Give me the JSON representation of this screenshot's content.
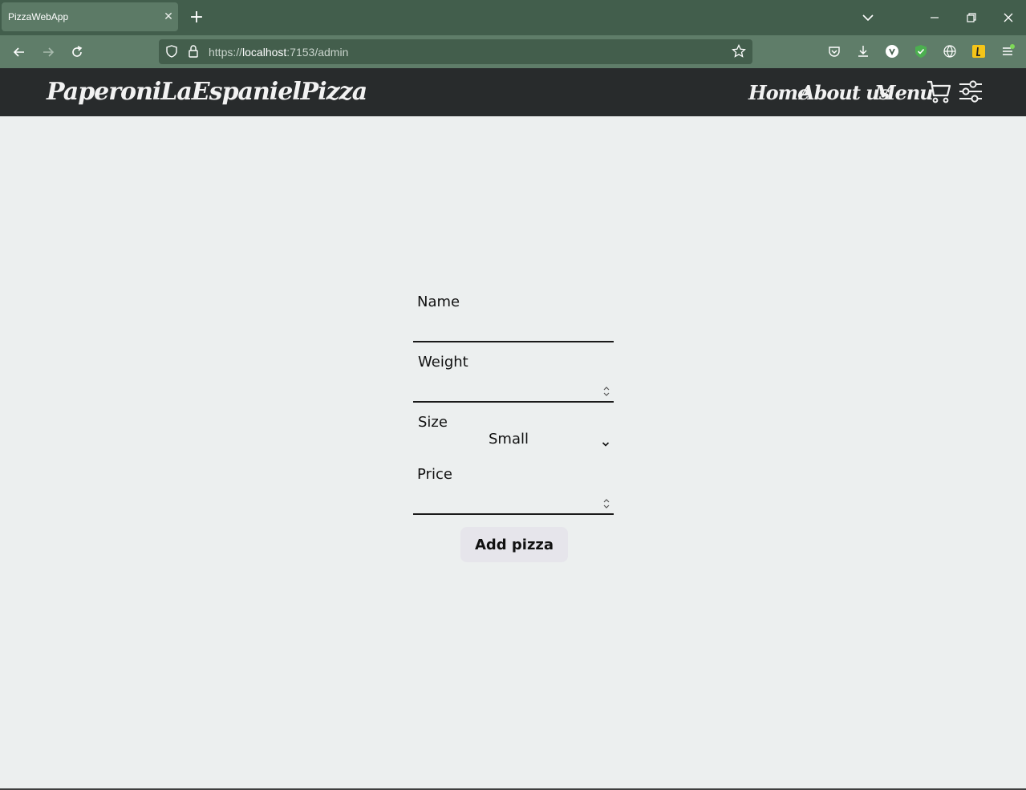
{
  "browser": {
    "tab_title": "PizzaWebApp",
    "url_prefix": "https://",
    "url_host": "localhost",
    "url_path": ":7153/admin",
    "colors": {
      "tabbar": "#425e4c",
      "toolbar": "#5f7d69",
      "urlbar": "#435e4c"
    }
  },
  "site": {
    "brand": "PaperoniLaEspanielPizza",
    "nav": {
      "home": "Home",
      "about": "About us",
      "menu": "Menu"
    },
    "icons": {
      "cart": "cart-icon",
      "settings": "sliders-icon"
    },
    "colors": {
      "header_bg": "#282b2c",
      "page_bg": "#ecefef"
    }
  },
  "form": {
    "name_label": "Name",
    "weight_label": "Weight",
    "size_label": "Size",
    "size_selected": "Small",
    "price_label": "Price",
    "submit_label": "Add pizza"
  }
}
